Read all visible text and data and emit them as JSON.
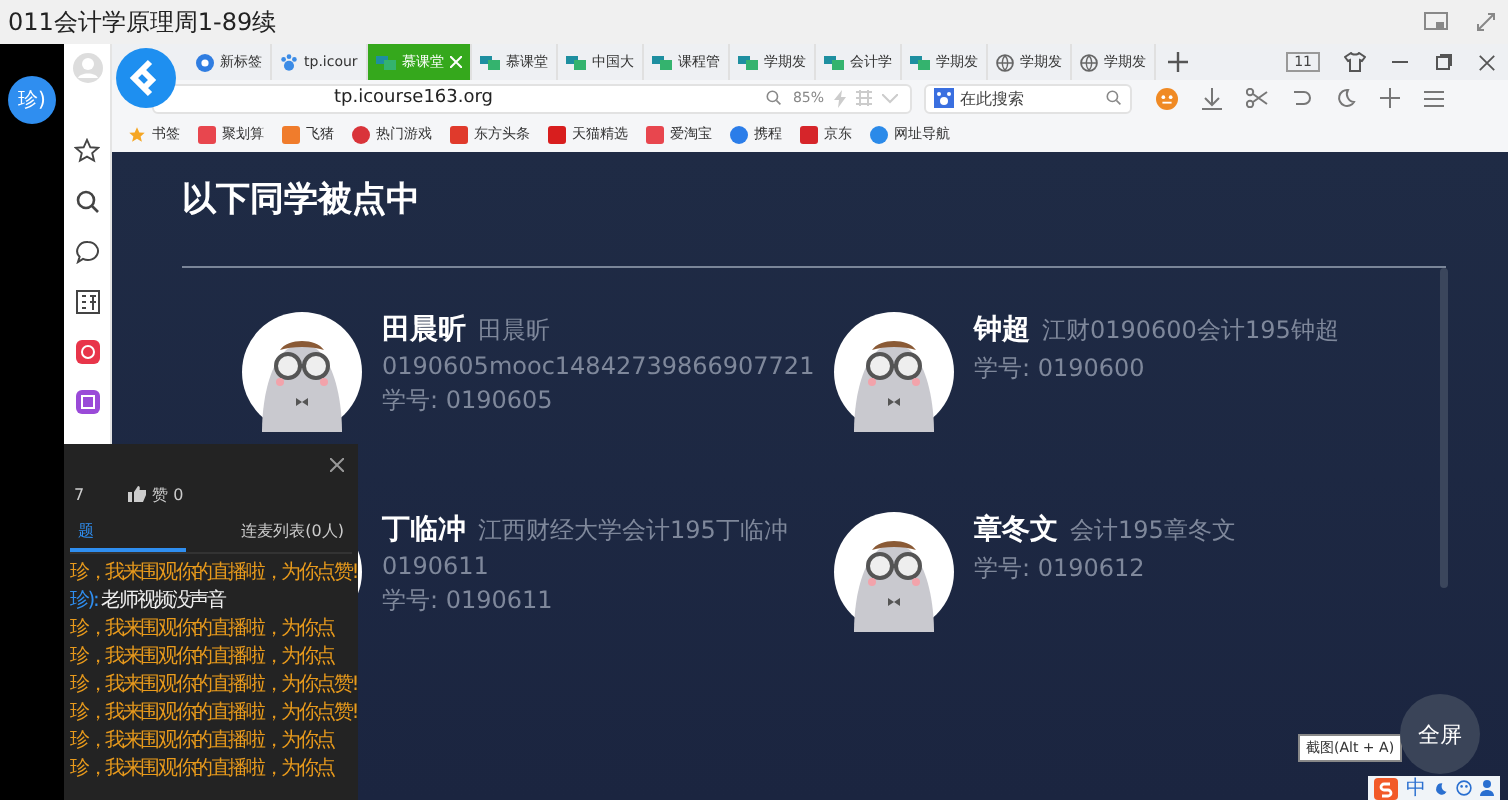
{
  "window": {
    "title": "011会计学原理周1-89续"
  },
  "side_badge": {
    "text": "珍)"
  },
  "tabs": [
    {
      "label": "新标签",
      "kind": "round",
      "selected": false
    },
    {
      "label": "tp.icour",
      "kind": "paw",
      "selected": false
    },
    {
      "label": "慕课堂",
      "kind": "mooc",
      "selected": true
    },
    {
      "label": "慕课堂",
      "kind": "mooc",
      "selected": false
    },
    {
      "label": "中国大",
      "kind": "mooc",
      "selected": false
    },
    {
      "label": "课程管",
      "kind": "mooc",
      "selected": false
    },
    {
      "label": "学期发",
      "kind": "mooc",
      "selected": false
    },
    {
      "label": "会计学",
      "kind": "mooc",
      "selected": false
    },
    {
      "label": "学期发",
      "kind": "mooc",
      "selected": false
    },
    {
      "label": "学期发",
      "kind": "globe",
      "selected": false
    },
    {
      "label": "学期发",
      "kind": "globe",
      "selected": false
    }
  ],
  "tab_count": "11",
  "address": {
    "url": "tp.icourse163.org",
    "zoom": "85%"
  },
  "search": {
    "placeholder": "在此搜索"
  },
  "bookmarks": [
    {
      "label": "书签",
      "kind": "star",
      "color": "#f5a623"
    },
    {
      "label": "聚划算",
      "kind": "square",
      "color": "#e8464e"
    },
    {
      "label": "飞猪",
      "kind": "square",
      "color": "#f07c2c"
    },
    {
      "label": "热门游戏",
      "kind": "circle",
      "color": "#d9343a"
    },
    {
      "label": "东方头条",
      "kind": "square",
      "color": "#e03a2c"
    },
    {
      "label": "天猫精选",
      "kind": "square",
      "color": "#d81e1e"
    },
    {
      "label": "爱淘宝",
      "kind": "square",
      "color": "#e8464e"
    },
    {
      "label": "携程",
      "kind": "circle",
      "color": "#2b7de9"
    },
    {
      "label": "京东",
      "kind": "square",
      "color": "#d6252a"
    },
    {
      "label": "网址导航",
      "kind": "circle",
      "color": "#2b8ae9"
    }
  ],
  "heading": "以下同学被点中",
  "students": [
    {
      "name": "田晨昕",
      "remark": "田晨昕",
      "extra": "0190605mooc14842739866907721",
      "number": "学号: 0190605"
    },
    {
      "name": "钟超",
      "remark": "江财0190600会计195钟超",
      "number": "学号: 0190600"
    },
    {
      "name": "丁临冲",
      "remark": "江西财经大学会计195丁临冲",
      "extra": "0190611",
      "number": "学号: 0190611"
    },
    {
      "name": "章冬文",
      "remark": "会计195章冬文",
      "number": "学号: 0190612"
    }
  ],
  "chat": {
    "count": "7",
    "likes": "赞 0",
    "tabs": [
      {
        "label": "题",
        "selected": true
      },
      {
        "label": "连麦列表(0人)",
        "selected": false
      }
    ],
    "messages": [
      {
        "kind": "system",
        "text": "珍，我来围观你的直播啦，为你点赞!"
      },
      {
        "kind": "user",
        "name": "珍):",
        "text": "老师视频没声音"
      },
      {
        "kind": "system",
        "text": "珍，我来围观你的直播啦，为你点"
      },
      {
        "kind": "system",
        "text": "珍，我来围观你的直播啦，为你点"
      },
      {
        "kind": "system",
        "text": "珍，我来围观你的直播啦，为你点赞!"
      },
      {
        "kind": "system",
        "text": "珍，我来围观你的直播啦，为你点赞!"
      },
      {
        "kind": "system",
        "text": "珍，我来围观你的直播啦，为你点"
      },
      {
        "kind": "system",
        "text": "珍，我来围观你的直播啦，为你点"
      }
    ]
  },
  "tooltip": "截图(Alt + A)",
  "fullscreen": "全屏",
  "tray": {
    "ime": "中"
  }
}
